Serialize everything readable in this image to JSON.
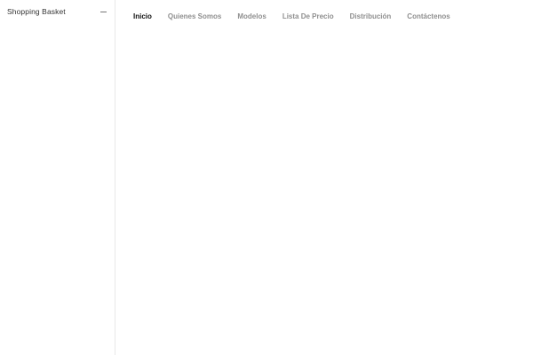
{
  "sidebar": {
    "title": "Shopping Basket",
    "toggle_icon": "minus-icon"
  },
  "nav": {
    "items": [
      {
        "label": "Inicio",
        "active": true
      },
      {
        "label": "Quienes Somos",
        "active": false
      },
      {
        "label": "Modelos",
        "active": false
      },
      {
        "label": "Lista De Precio",
        "active": false
      },
      {
        "label": "Distribución",
        "active": false
      },
      {
        "label": "Contáctenos",
        "active": false
      }
    ]
  },
  "colors": {
    "active_nav": "#111111",
    "inactive_nav": "#8f8f8f",
    "divider": "#e8e8e8"
  }
}
